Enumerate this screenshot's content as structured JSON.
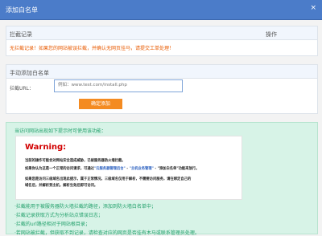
{
  "window": {
    "title": "添加白名单",
    "close_label": "×"
  },
  "intercept_panel": {
    "col_record": "拦截记录",
    "col_action": "操作",
    "empty_row": "无拦截记录！如果您的网站被误拦截，并确认无网页挂马，请提交工单处理！"
  },
  "manual_panel": {
    "title": "手动添加白名单",
    "url_label": "拦截URL：",
    "url_placeholder": "例如：www.test.com/install.php",
    "submit": "确定添加"
  },
  "notice": {
    "header": "当访问网站出现如下提示时可使用该功能：",
    "warning_title": "Warning:",
    "warning_line1": "当前的操作可能会对网站安全造成威胁，已被服务器防火墙拦截。",
    "warning_line2_a": "如果你认为这是一个正常的访问请求，可通过",
    "warning_line2_link1": "\"云服务器管理后台\"",
    "warning_line2_b": " - ",
    "warning_line2_link2": "\"主机业务管理\"",
    "warning_line2_c": " - \"添加白名单\"功能来放行。",
    "warning_line3": "如果您是访问三级域名出现此提示，属于正常情况，三级域名仅用于解析，不需要访问服务，请在绑定自己的",
    "warning_line4": "域名后，并解析到主机，解析生效后即可访问。",
    "bullet1": "·拦截能用于被服务器防火墙拦截的路径，添加到防火墙白名单中；",
    "bullet2": "·拦截记录获取方式为分析站点错误日志；",
    "bullet3": "·拦截的url路径相对于网站根目录；",
    "bullet4": "·若网站被拦截，但获取不到记录，请检查对应的网页是否挂有木马或联系管理员处理。"
  }
}
